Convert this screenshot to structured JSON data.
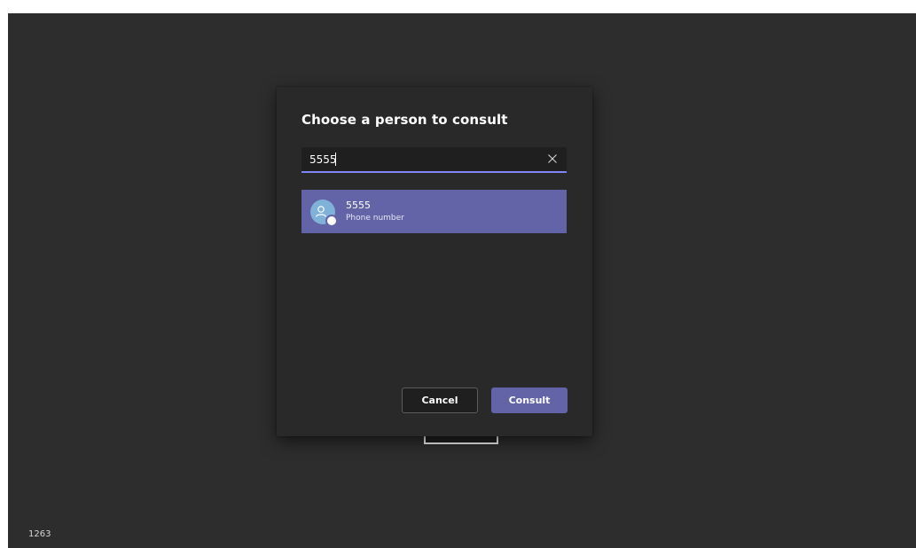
{
  "dialog": {
    "title": "Choose a person to consult",
    "search": {
      "value": "5555",
      "placeholder": ""
    },
    "results": [
      {
        "name": "5555",
        "subtitle": "Phone number"
      }
    ],
    "buttons": {
      "cancel": "Cancel",
      "consult": "Consult"
    }
  },
  "corner_label": "1263",
  "icons": {
    "clear": "close-icon",
    "avatar": "phone-contact-icon"
  },
  "colors": {
    "background": "#2d2d2d",
    "dialog": "#292929",
    "accent": "#6264a7",
    "focus_underline": "#7f85f5",
    "avatar": "#7fb1d9"
  }
}
